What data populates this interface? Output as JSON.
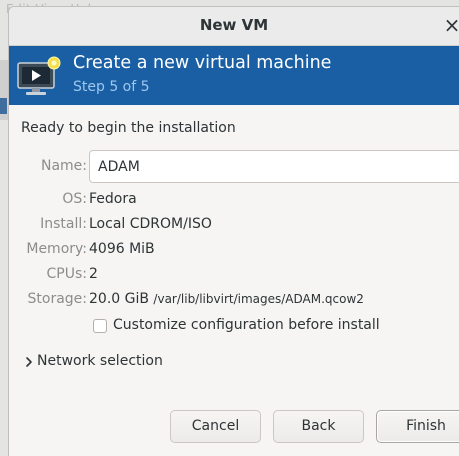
{
  "background_window": {
    "title_fragment": "Edit View Help"
  },
  "dialog": {
    "title": "New VM",
    "close_glyph": "×"
  },
  "banner": {
    "heading": "Create a new virtual machine",
    "step": "Step 5 of 5",
    "icon": "vm-monitor-icon",
    "color": "#1a5fa4"
  },
  "summary": {
    "ready_text": "Ready to begin the installation",
    "name_label": "Name:",
    "name_value": "ADAM",
    "rows": [
      {
        "label": "OS:",
        "value": "Fedora"
      },
      {
        "label": "Install:",
        "value": "Local CDROM/ISO"
      },
      {
        "label": "Memory:",
        "value": "4096 MiB"
      },
      {
        "label": "CPUs:",
        "value": "2"
      }
    ],
    "storage": {
      "label": "Storage:",
      "size": "20.0 GiB",
      "path": "/var/lib/libvirt/images/ADAM.qcow2"
    }
  },
  "options": {
    "customize_label": "Customize configuration before install",
    "customize_checked": false,
    "network_label": "Network selection",
    "network_expanded": false
  },
  "buttons": {
    "cancel": "Cancel",
    "back": "Back",
    "finish": "Finish"
  }
}
